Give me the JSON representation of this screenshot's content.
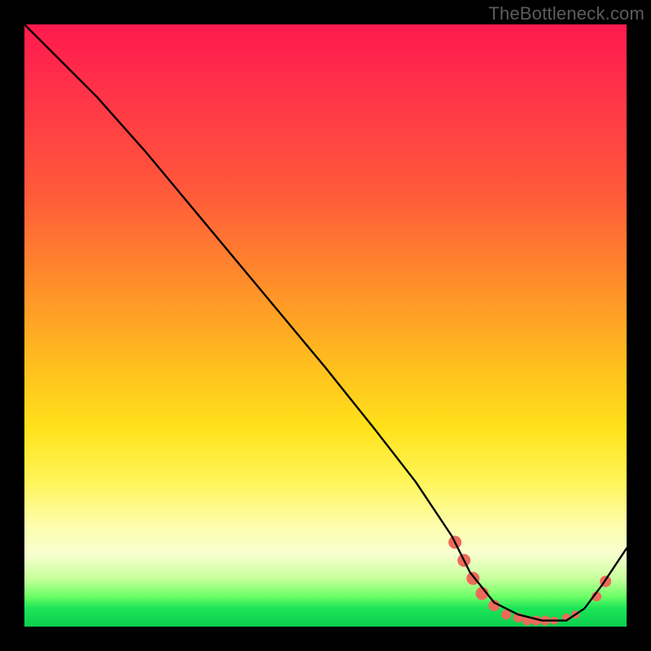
{
  "watermark": "TheBottleneck.com",
  "chart_data": {
    "type": "line",
    "title": "",
    "xlabel": "",
    "ylabel": "",
    "xlim": [
      0,
      100
    ],
    "ylim": [
      0,
      100
    ],
    "grid": false,
    "legend": false,
    "series": [
      {
        "name": "curve",
        "color": "#000000",
        "x": [
          0,
          6,
          12,
          20,
          30,
          40,
          50,
          58,
          65,
          71,
          74,
          78,
          82,
          86,
          90,
          93,
          96,
          100
        ],
        "y": [
          100,
          94,
          88,
          79,
          67,
          55,
          43,
          33,
          24,
          15,
          9,
          4,
          2,
          1,
          1,
          3,
          7,
          13
        ]
      }
    ],
    "markers": [
      {
        "x": 71.5,
        "y": 14.0,
        "r": 8,
        "color": "#ed6a5a"
      },
      {
        "x": 73.0,
        "y": 11.0,
        "r": 8,
        "color": "#ed6a5a"
      },
      {
        "x": 74.5,
        "y": 8.0,
        "r": 8,
        "color": "#ed6a5a"
      },
      {
        "x": 76.0,
        "y": 5.5,
        "r": 8,
        "color": "#ed6a5a"
      },
      {
        "x": 78.0,
        "y": 3.5,
        "r": 7,
        "color": "#ed6a5a"
      },
      {
        "x": 80.0,
        "y": 2.0,
        "r": 6,
        "color": "#ed6a5a"
      },
      {
        "x": 82.0,
        "y": 1.5,
        "r": 6,
        "color": "#ed6a5a"
      },
      {
        "x": 83.5,
        "y": 1.0,
        "r": 6,
        "color": "#ed6a5a"
      },
      {
        "x": 85.0,
        "y": 1.0,
        "r": 6,
        "color": "#ed6a5a"
      },
      {
        "x": 86.5,
        "y": 1.0,
        "r": 6,
        "color": "#ed6a5a"
      },
      {
        "x": 88.0,
        "y": 1.0,
        "r": 5,
        "color": "#ed6a5a"
      },
      {
        "x": 90.0,
        "y": 1.5,
        "r": 5,
        "color": "#ed6a5a"
      },
      {
        "x": 91.5,
        "y": 2.0,
        "r": 5,
        "color": "#ed6a5a"
      },
      {
        "x": 95.0,
        "y": 5.0,
        "r": 6,
        "color": "#ed6a5a"
      },
      {
        "x": 96.5,
        "y": 7.5,
        "r": 7,
        "color": "#ed6a5a"
      }
    ]
  }
}
